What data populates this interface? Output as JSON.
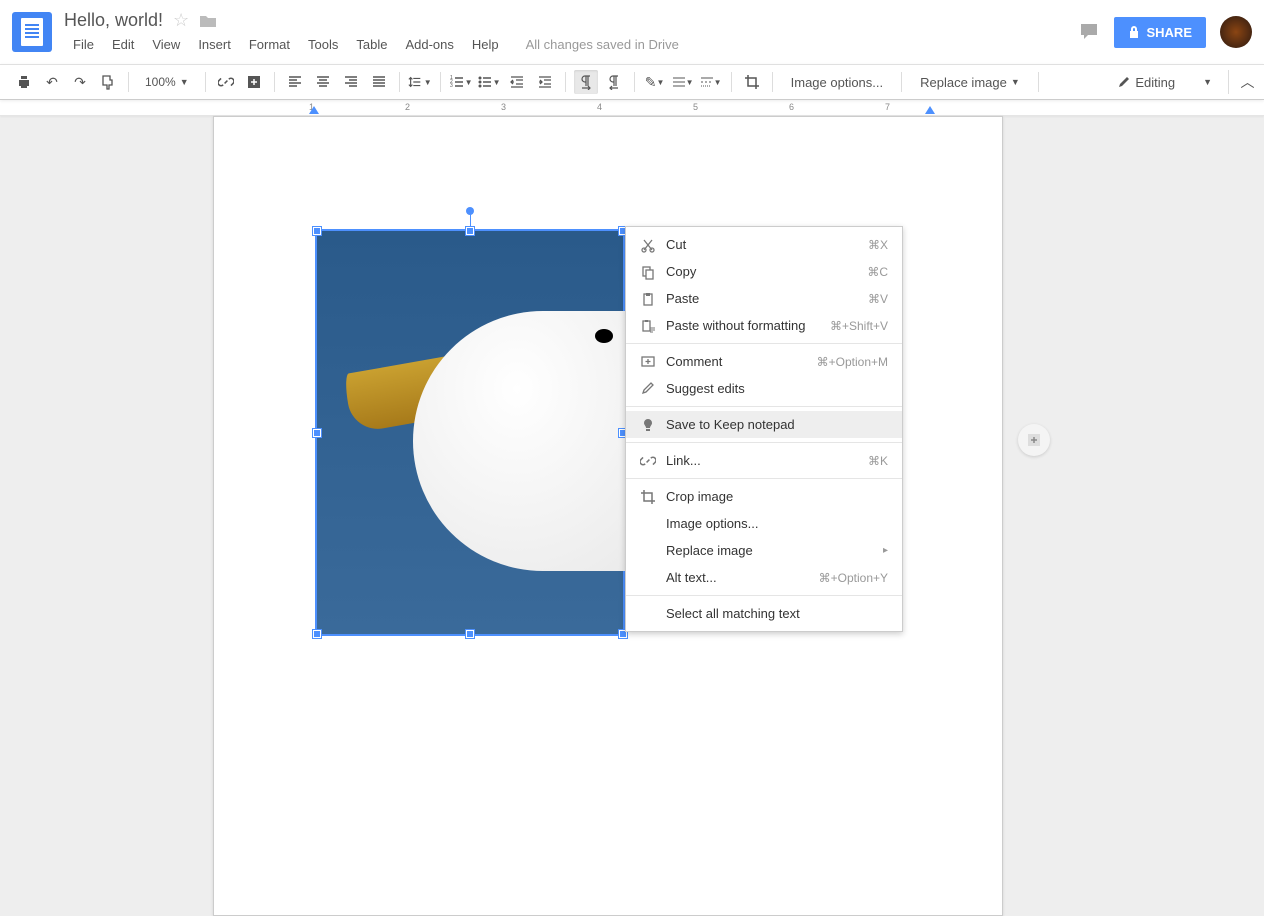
{
  "header": {
    "doc_title": "Hello, world!",
    "menus": [
      "File",
      "Edit",
      "View",
      "Insert",
      "Format",
      "Tools",
      "Table",
      "Add-ons",
      "Help"
    ],
    "status": "All changes saved in Drive",
    "share_label": "SHARE"
  },
  "toolbar": {
    "zoom": "100%",
    "image_options": "Image options...",
    "replace_image": "Replace image",
    "editing": "Editing"
  },
  "ruler": {
    "numbers": [
      1,
      2,
      3,
      4,
      5,
      6,
      7
    ]
  },
  "context_menu": {
    "items": [
      {
        "icon": "cut",
        "label": "Cut",
        "shortcut": "⌘X"
      },
      {
        "icon": "copy",
        "label": "Copy",
        "shortcut": "⌘C"
      },
      {
        "icon": "paste",
        "label": "Paste",
        "shortcut": "⌘V"
      },
      {
        "icon": "paste-plain",
        "label": "Paste without formatting",
        "shortcut": "⌘+Shift+V"
      },
      {
        "sep": true
      },
      {
        "icon": "comment",
        "label": "Comment",
        "shortcut": "⌘+Option+M"
      },
      {
        "icon": "suggest",
        "label": "Suggest edits",
        "shortcut": ""
      },
      {
        "sep": true
      },
      {
        "icon": "keep",
        "label": "Save to Keep notepad",
        "shortcut": "",
        "hover": true
      },
      {
        "sep": true
      },
      {
        "icon": "link",
        "label": "Link...",
        "shortcut": "⌘K"
      },
      {
        "sep": true
      },
      {
        "icon": "crop",
        "label": "Crop image",
        "shortcut": ""
      },
      {
        "icon": "",
        "label": "Image options...",
        "shortcut": ""
      },
      {
        "icon": "",
        "label": "Replace image",
        "shortcut": "",
        "submenu": true
      },
      {
        "icon": "",
        "label": "Alt text...",
        "shortcut": "⌘+Option+Y"
      },
      {
        "sep": true
      },
      {
        "icon": "",
        "label": "Select all matching text",
        "shortcut": ""
      }
    ]
  }
}
